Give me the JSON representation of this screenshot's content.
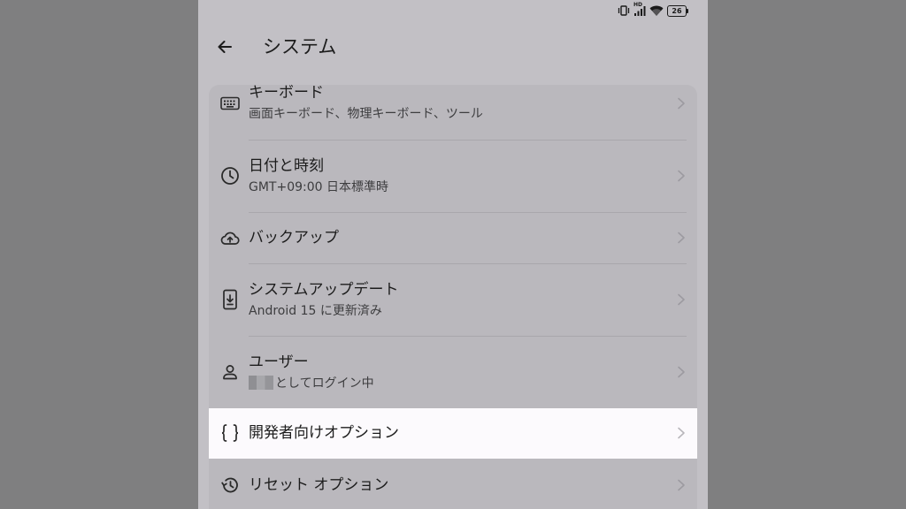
{
  "status": {
    "battery": "26",
    "network_label": "HD"
  },
  "header": {
    "title": "システム"
  },
  "settings": [
    {
      "title": "キーボード",
      "subtitle": "画面キーボード、物理キーボード、ツール",
      "icon": "keyboard-icon"
    },
    {
      "title": "日付と時刻",
      "subtitle": "GMT+09:00 日本標準時",
      "icon": "clock-icon"
    },
    {
      "title": "バックアップ",
      "subtitle": "",
      "icon": "cloud-upload-icon"
    },
    {
      "title": "システムアップデート",
      "subtitle": "Android 15 に更新済み",
      "icon": "system-update-icon"
    },
    {
      "title": "ユーザー",
      "subtitle": "としてログイン中",
      "icon": "person-icon"
    },
    {
      "title": "開発者向けオプション",
      "subtitle": "",
      "icon": "code-braces-icon"
    },
    {
      "title": "リセット オプション",
      "subtitle": "",
      "icon": "history-icon"
    }
  ],
  "colors": {
    "background": "#7f7f80",
    "screen": "#c2c0c5",
    "card": "#bab8bd",
    "highlight": "#fcfafd"
  }
}
